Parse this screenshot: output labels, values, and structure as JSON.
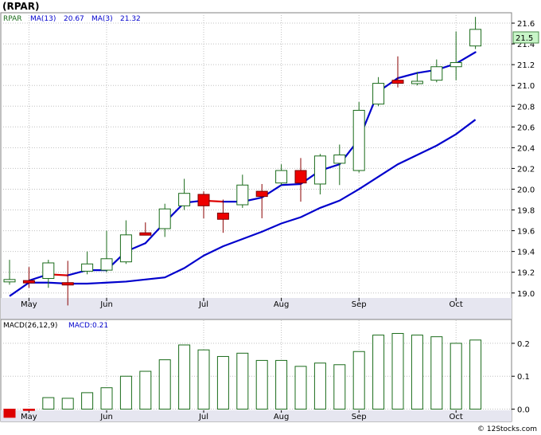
{
  "title": "(RPAR)",
  "credit": "© 12Stocks.com",
  "colors": {
    "up_candle_fill": "#ffffff",
    "up_candle_stroke": "#1a6b1a",
    "down_candle_fill": "#ee0000",
    "ma13_line": "#0000cc",
    "ma3_line_up": "#0000cc",
    "ma3_line_down": "#dd0000",
    "macd_bar_pos": "#1a6b1a",
    "macd_bar_neg": "#dd0000",
    "grid": "#c0c0c0",
    "axis_band": "#e6e6f0",
    "last_price_box": "#c8f5c8"
  },
  "legend": {
    "symbol": "RPAR",
    "ma13_label": "MA(13)",
    "ma13_value": "20.67",
    "ma3_label": "MA(3)",
    "ma3_value": "21.32",
    "macd_label": "MACD(26,12,9)",
    "macd_value_label": "MACD:0.21"
  },
  "last_price": "21.5",
  "month_labels": [
    "May",
    "Jun",
    "Jul",
    "Aug",
    "Sep",
    "Oct"
  ],
  "chart_data": [
    {
      "type": "candlestick",
      "title": "(RPAR)",
      "x": [
        "Apr W5",
        "May W1",
        "May W2",
        "May W3",
        "May W4",
        "Jun W1",
        "Jun W2",
        "Jun W3",
        "Jun W4",
        "Jun W5",
        "Jul W1",
        "Jul W2",
        "Jul W3",
        "Jul W4",
        "Aug W1",
        "Aug W2",
        "Aug W3",
        "Aug W4",
        "Sep W1",
        "Sep W2",
        "Sep W3",
        "Sep W4",
        "Oct W1",
        "Oct W2",
        "Oct W3"
      ],
      "open": [
        19.11,
        19.12,
        19.14,
        19.1,
        19.21,
        19.22,
        19.3,
        19.58,
        19.62,
        19.84,
        19.95,
        19.77,
        19.85,
        19.98,
        20.06,
        20.18,
        20.05,
        20.25,
        20.18,
        20.82,
        21.05,
        21.02,
        21.05,
        21.18,
        21.38
      ],
      "high": [
        19.32,
        19.25,
        19.32,
        19.31,
        19.4,
        19.6,
        19.7,
        19.68,
        19.86,
        20.1,
        19.98,
        19.9,
        20.14,
        20.05,
        20.24,
        20.3,
        20.34,
        20.43,
        20.84,
        21.08,
        21.28,
        21.13,
        21.25,
        21.52,
        21.66
      ],
      "low": [
        19.08,
        19.05,
        19.05,
        18.88,
        19.18,
        19.2,
        19.28,
        19.56,
        19.54,
        19.8,
        19.72,
        19.58,
        19.82,
        19.72,
        20.04,
        19.88,
        19.95,
        20.04,
        20.16,
        20.8,
        20.98,
        21.0,
        21.03,
        21.05,
        21.35
      ],
      "close": [
        19.13,
        19.11,
        19.29,
        19.08,
        19.28,
        19.33,
        19.56,
        19.56,
        19.81,
        19.96,
        19.84,
        19.71,
        20.04,
        19.93,
        20.18,
        20.06,
        20.32,
        20.33,
        20.76,
        21.02,
        21.02,
        21.04,
        21.18,
        21.22,
        21.54
      ],
      "series": [
        {
          "name": "MA(13)",
          "values": [
            18.97,
            19.1,
            19.1,
            19.09,
            19.09,
            19.1,
            19.11,
            19.13,
            19.15,
            19.24,
            19.36,
            19.45,
            19.52,
            19.59,
            19.67,
            19.73,
            19.82,
            19.89,
            20.0,
            20.12,
            20.24,
            20.33,
            20.42,
            20.53,
            20.67
          ]
        },
        {
          "name": "MA(3)",
          "values": [
            null,
            19.12,
            19.18,
            19.17,
            19.22,
            19.22,
            19.4,
            19.48,
            19.68,
            19.87,
            19.89,
            19.88,
            19.88,
            19.92,
            20.04,
            20.05,
            20.18,
            20.24,
            20.48,
            20.94,
            21.07,
            21.12,
            21.15,
            21.21,
            21.32
          ]
        }
      ],
      "yticks": [
        19.0,
        19.2,
        19.4,
        19.6,
        19.8,
        20.0,
        20.2,
        20.4,
        20.6,
        20.8,
        21.0,
        21.2,
        21.4,
        21.6
      ],
      "ylim": [
        18.86,
        21.7
      ],
      "grid": true
    },
    {
      "type": "bar",
      "title": "MACD(26,12,9)",
      "x": [
        "Apr W5",
        "May W1",
        "May W2",
        "May W3",
        "May W4",
        "Jun W1",
        "Jun W2",
        "Jun W3",
        "Jun W4",
        "Jun W5",
        "Jul W1",
        "Jul W2",
        "Jul W3",
        "Jul W4",
        "Aug W1",
        "Aug W2",
        "Aug W3",
        "Aug W4",
        "Sep W1",
        "Sep W2",
        "Sep W3",
        "Sep W4",
        "Oct W1",
        "Oct W2",
        "Oct W3"
      ],
      "values": [
        -0.025,
        -0.004,
        0.035,
        0.033,
        0.05,
        0.065,
        0.1,
        0.115,
        0.15,
        0.195,
        0.18,
        0.16,
        0.17,
        0.148,
        0.148,
        0.13,
        0.14,
        0.135,
        0.175,
        0.225,
        0.23,
        0.225,
        0.22,
        0.2,
        0.21
      ],
      "yticks": [
        0.0,
        0.1,
        0.2
      ],
      "ylim": [
        -0.035,
        0.27
      ],
      "grid": true
    }
  ]
}
